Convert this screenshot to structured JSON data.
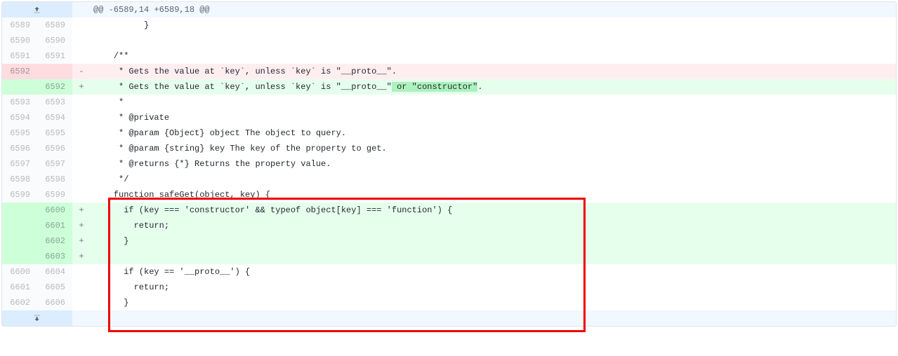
{
  "hunk_header": "@@ -6589,14 +6589,18 @@",
  "lines": [
    {
      "old": "6589",
      "new": "6589",
      "type": "context",
      "marker": "",
      "code": "          }"
    },
    {
      "old": "6590",
      "new": "6590",
      "type": "context",
      "marker": "",
      "code": ""
    },
    {
      "old": "6591",
      "new": "6591",
      "type": "context",
      "marker": "",
      "code": "    /**"
    },
    {
      "old": "6592",
      "new": "",
      "type": "deletion",
      "marker": "-",
      "code": "     * Gets the value at `key`, unless `key` is \"__proto__\"."
    },
    {
      "old": "",
      "new": "6592",
      "type": "addition",
      "marker": "+",
      "code_pre": "     * Gets the value at `key`, unless `key` is \"__proto__\"",
      "code_hl": " or \"constructor\"",
      "code_post": "."
    },
    {
      "old": "6593",
      "new": "6593",
      "type": "context",
      "marker": "",
      "code": "     *"
    },
    {
      "old": "6594",
      "new": "6594",
      "type": "context",
      "marker": "",
      "code": "     * @private"
    },
    {
      "old": "6595",
      "new": "6595",
      "type": "context",
      "marker": "",
      "code": "     * @param {Object} object The object to query."
    },
    {
      "old": "6596",
      "new": "6596",
      "type": "context",
      "marker": "",
      "code": "     * @param {string} key The key of the property to get."
    },
    {
      "old": "6597",
      "new": "6597",
      "type": "context",
      "marker": "",
      "code": "     * @returns {*} Returns the property value."
    },
    {
      "old": "6598",
      "new": "6598",
      "type": "context",
      "marker": "",
      "code": "     */"
    },
    {
      "old": "6599",
      "new": "6599",
      "type": "context",
      "marker": "",
      "code": "    function safeGet(object, key) {"
    },
    {
      "old": "",
      "new": "6600",
      "type": "addition",
      "marker": "+",
      "code": "      if (key === 'constructor' && typeof object[key] === 'function') {"
    },
    {
      "old": "",
      "new": "6601",
      "type": "addition",
      "marker": "+",
      "code": "        return;"
    },
    {
      "old": "",
      "new": "6602",
      "type": "addition",
      "marker": "+",
      "code": "      }"
    },
    {
      "old": "",
      "new": "6603",
      "type": "addition",
      "marker": "+",
      "code": ""
    },
    {
      "old": "6600",
      "new": "6604",
      "type": "context",
      "marker": "",
      "code": "      if (key == '__proto__') {"
    },
    {
      "old": "6601",
      "new": "6605",
      "type": "context",
      "marker": "",
      "code": "        return;"
    },
    {
      "old": "6602",
      "new": "6606",
      "type": "context",
      "marker": "",
      "code": "      }"
    }
  ]
}
